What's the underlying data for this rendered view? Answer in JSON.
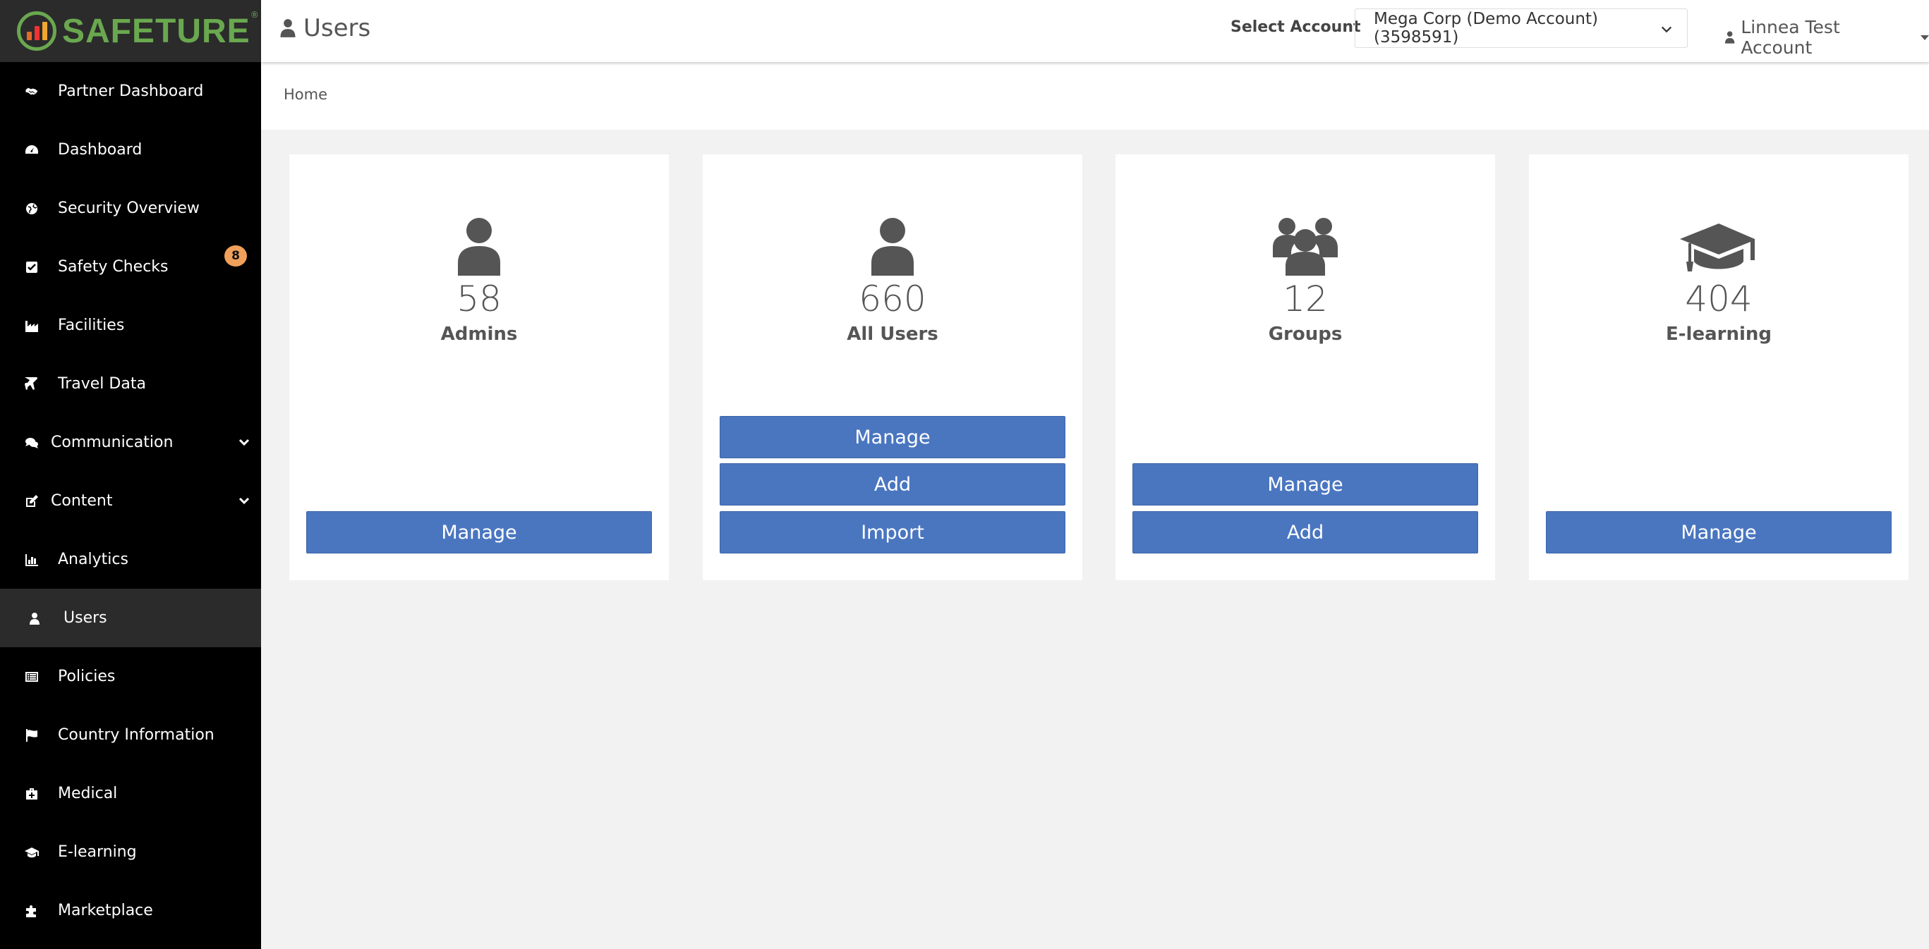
{
  "brand": {
    "name": "SAFETURE",
    "reg": "®"
  },
  "sidebar": {
    "items": [
      {
        "label": "Partner Dashboard",
        "icon": "handshake-icon"
      },
      {
        "label": "Dashboard",
        "icon": "dashboard-icon"
      },
      {
        "label": "Security Overview",
        "icon": "globe-icon"
      },
      {
        "label": "Safety Checks",
        "icon": "check-square-icon",
        "badge": "8"
      },
      {
        "label": "Facilities",
        "icon": "industry-icon"
      },
      {
        "label": "Travel Data",
        "icon": "plane-icon"
      },
      {
        "label": "Communication",
        "icon": "comments-icon",
        "expandable": true
      },
      {
        "label": "Content",
        "icon": "edit-icon",
        "expandable": true
      },
      {
        "label": "Analytics",
        "icon": "bar-chart-icon"
      },
      {
        "label": "Users",
        "icon": "user-icon",
        "active": true
      },
      {
        "label": "Policies",
        "icon": "list-alt-icon"
      },
      {
        "label": "Country Information",
        "icon": "flag-icon"
      },
      {
        "label": "Medical",
        "icon": "medkit-icon"
      },
      {
        "label": "E-learning",
        "icon": "graduation-cap-icon"
      },
      {
        "label": "Marketplace",
        "icon": "puzzle-icon"
      }
    ]
  },
  "header": {
    "title": "Users",
    "select_label": "Select Account",
    "account": "Mega Corp (Demo Account) (3598591)",
    "user": "Linnea Test Account"
  },
  "breadcrumb": "Home",
  "cards": [
    {
      "count": "58",
      "label": "Admins",
      "buttons": [
        "Manage"
      ]
    },
    {
      "count": "660",
      "label": "All Users",
      "buttons": [
        "Manage",
        "Add",
        "Import"
      ]
    },
    {
      "count": "12",
      "label": "Groups",
      "buttons": [
        "Manage",
        "Add"
      ]
    },
    {
      "count": "404",
      "label": "E-learning",
      "buttons": [
        "Manage"
      ]
    }
  ],
  "colors": {
    "button": "#4a76c0",
    "sidebar": "#000000",
    "active": "#2b2b2b",
    "badge": "#f0a05a",
    "brand": "#6aa84f"
  }
}
